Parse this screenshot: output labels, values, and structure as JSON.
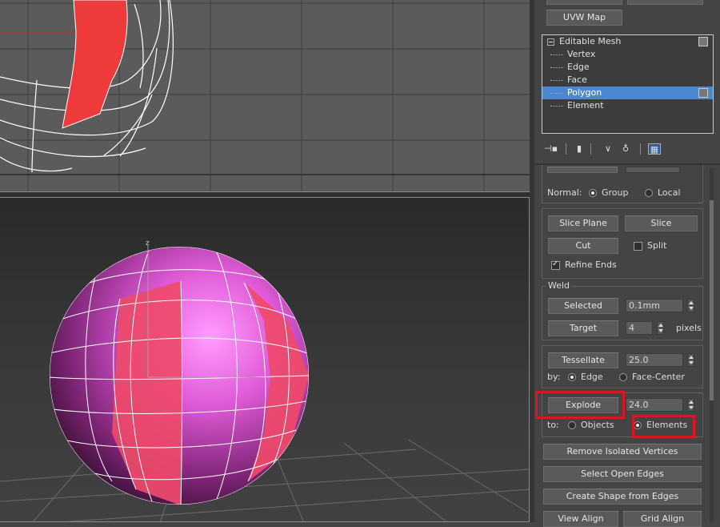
{
  "modifier_panel": {
    "uvw_map_button": "UVW Map",
    "stack": {
      "root": "Editable Mesh",
      "sub_objects": [
        "Vertex",
        "Edge",
        "Face",
        "Polygon",
        "Element"
      ],
      "selected": "Polygon"
    }
  },
  "edit_geometry": {
    "normal_label": "Normal:",
    "normal_options": [
      "Group",
      "Local"
    ],
    "normal_selected": "Group",
    "slice_plane_button": "Slice Plane",
    "slice_button": "Slice",
    "cut_button": "Cut",
    "split_label": "Split",
    "split_checked": false,
    "refine_ends_label": "Refine Ends",
    "refine_ends_checked": true,
    "weld": {
      "title": "Weld",
      "selected_button": "Selected",
      "selected_value": "0.1mm",
      "target_button": "Target",
      "target_value": "4",
      "target_unit": "pixels"
    },
    "tessellate": {
      "button": "Tessellate",
      "value": "25.0",
      "by_label": "by:",
      "options": [
        "Edge",
        "Face-Center"
      ],
      "selected": "Edge"
    },
    "explode": {
      "button": "Explode",
      "value": "24.0",
      "to_label": "to:",
      "options": [
        "Objects",
        "Elements"
      ],
      "selected": "Elements"
    },
    "remove_isolated_button": "Remove Isolated Vertices",
    "select_open_edges_button": "Select Open Edges",
    "create_shape_button": "Create Shape from Edges",
    "view_align_button": "View Align",
    "grid_align_button": "Grid Align"
  },
  "viewport": {
    "axis_label": "z"
  },
  "colors": {
    "selection_red": "#ee3a3a",
    "highlight_box": "#e0141e",
    "stack_selection": "#4c88d0",
    "sphere_magenta": "#e05ad8"
  }
}
